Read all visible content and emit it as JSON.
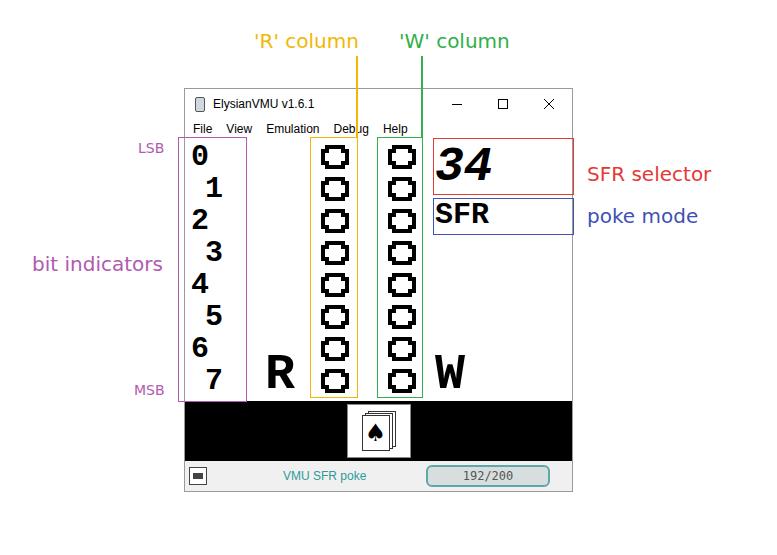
{
  "annotations": {
    "r_column": "'R' column",
    "w_column": "'W' column",
    "lsb": "LSB",
    "msb": "MSB",
    "bit_indicators": "bit indicators",
    "sfr_selector": "SFR selector",
    "poke_mode": "poke mode"
  },
  "window": {
    "title": "ElysianVMU v1.6.1"
  },
  "menu": [
    "File",
    "View",
    "Emulation",
    "Debug",
    "Help"
  ],
  "lcd": {
    "bits": [
      {
        "label": "0",
        "read": false,
        "write": false
      },
      {
        "label": "1",
        "read": false,
        "write": false
      },
      {
        "label": "2",
        "read": false,
        "write": false
      },
      {
        "label": "3",
        "read": false,
        "write": false
      },
      {
        "label": "4",
        "read": false,
        "write": false
      },
      {
        "label": "5",
        "read": false,
        "write": false
      },
      {
        "label": "6",
        "read": false,
        "write": false
      },
      {
        "label": "7",
        "read": false,
        "write": false
      }
    ],
    "read_label": "R",
    "write_label": "W",
    "sfr": "34",
    "mode": "SFR"
  },
  "card_icon": "♠",
  "status_bar": {
    "mode": "VMU SFR poke",
    "counter": "192/200"
  }
}
